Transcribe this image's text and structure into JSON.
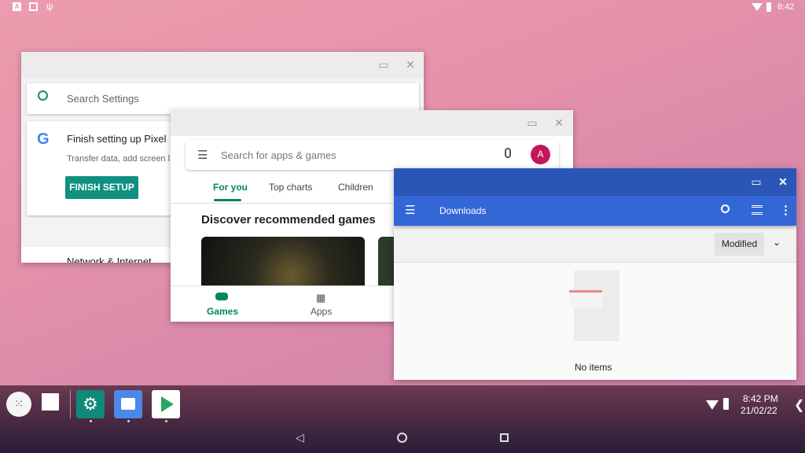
{
  "status_bar": {
    "time": "8:42",
    "icons": [
      "notification-a-icon",
      "image-icon",
      "usb-icon",
      "wifi-icon",
      "battery-icon"
    ]
  },
  "settings": {
    "search_placeholder": "Search Settings",
    "card_title": "Finish setting up Pixel",
    "card_text": "Transfer data, add screen l",
    "button": "FINISH SETUP",
    "next_item": "Network & Internet"
  },
  "play": {
    "search_placeholder": "Search for apps & games",
    "avatar": "A",
    "tabs": [
      "For you",
      "Top charts",
      "Children"
    ],
    "section": "Discover recommended games",
    "nav": [
      "Games",
      "Apps"
    ],
    "accent": "#01875f"
  },
  "files": {
    "title": "Downloads",
    "sort": "Modified",
    "empty": "No items",
    "titlebar_color": "#2a56b8",
    "toolbar_color": "#3367d6"
  },
  "taskbar": {
    "time": "8:42 PM",
    "date": "21/02/22",
    "apps": [
      "settings",
      "files",
      "play-store"
    ]
  }
}
